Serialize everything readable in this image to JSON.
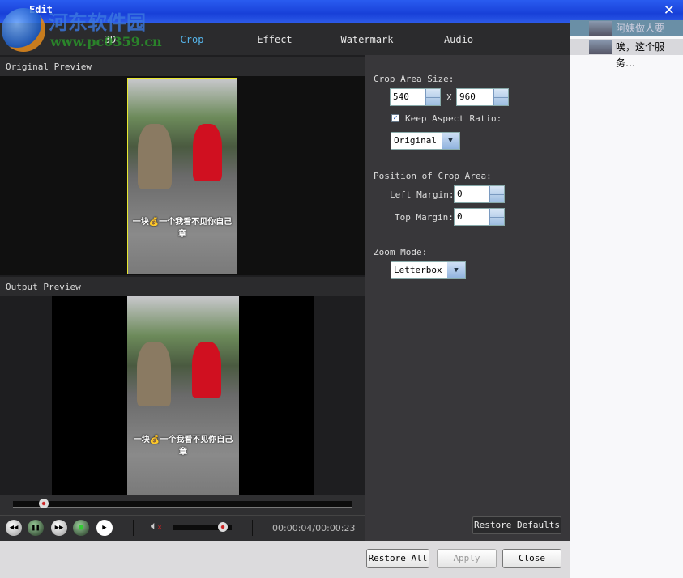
{
  "window": {
    "title": "Edit"
  },
  "watermark": {
    "line1": "河东软件园",
    "line2": "www.pc0359.cn"
  },
  "tabs": [
    {
      "label": "3D"
    },
    {
      "label": "Crop",
      "active": true
    },
    {
      "label": "Effect"
    },
    {
      "label": "Watermark"
    },
    {
      "label": "Audio"
    }
  ],
  "preview": {
    "original_label": "Original Preview",
    "output_label": "Output Preview",
    "subtitle_line1": "一块💰一个我看不见你自己",
    "subtitle_line2": "章"
  },
  "player": {
    "time": "00:00:04/00:00:23",
    "progress": 0.09,
    "volume": 0.85,
    "muted": true
  },
  "crop": {
    "area_size_label": "Crop Area Size:",
    "width": "540",
    "x_label": "X",
    "height": "960",
    "keep_aspect_label": "Keep Aspect Ratio:",
    "keep_aspect_checked": true,
    "aspect_value": "Original",
    "position_label": "Position of Crop Area:",
    "left_margin_label": "Left Margin:",
    "left_margin": "0",
    "top_margin_label": "Top Margin:",
    "top_margin": "0",
    "zoom_mode_label": "Zoom Mode:",
    "zoom_mode": "Letterbox",
    "restore_defaults": "Restore Defaults"
  },
  "buttons": {
    "restore_all": "Restore All",
    "apply": "Apply",
    "close": "Close"
  },
  "sidebar": {
    "items": [
      {
        "text": "阿姨做人要诚…"
      },
      {
        "text": "唉，这个服务…"
      }
    ]
  },
  "colors": {
    "accent": "#55b3e8",
    "titlebar": "#1840d8",
    "crop_frame": "#e8e830"
  }
}
